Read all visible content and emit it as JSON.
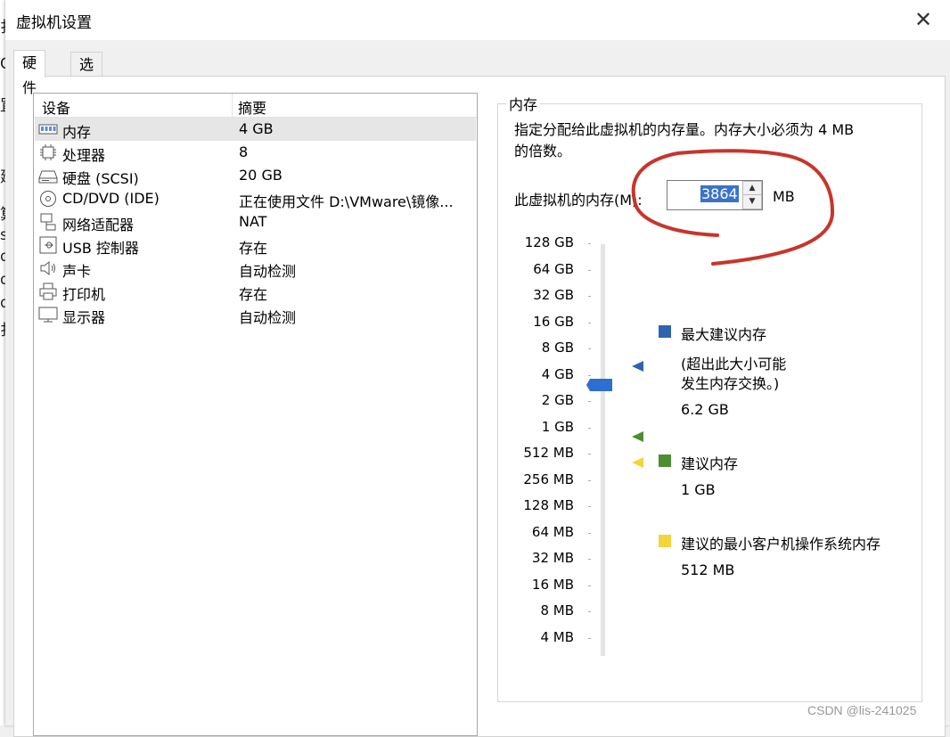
{
  "window": {
    "title": "虚拟机设置",
    "close_glyph": "✕"
  },
  "background_chars": [
    "扌",
    "C",
    "罝",
    "建",
    "算",
    "s",
    "d",
    "d",
    "d",
    "扌"
  ],
  "tabs": [
    {
      "label": "硬件",
      "active": true
    },
    {
      "label": "选项",
      "active": false
    }
  ],
  "device_list": {
    "headers": {
      "device": "设备",
      "summary": "摘要"
    },
    "rows": [
      {
        "icon": "memory-icon",
        "name": "内存",
        "summary": "4 GB",
        "selected": true
      },
      {
        "icon": "processor-icon",
        "name": "处理器",
        "summary": "8",
        "selected": false
      },
      {
        "icon": "harddisk-icon",
        "name": "硬盘 (SCSI)",
        "summary": "20 GB",
        "selected": false
      },
      {
        "icon": "cd-dvd-icon",
        "name": "CD/DVD (IDE)",
        "summary": "正在使用文件 D:\\VMware\\镜像...",
        "selected": false
      },
      {
        "icon": "network-adapter-icon",
        "name": "网络适配器",
        "summary": "NAT",
        "selected": false
      },
      {
        "icon": "usb-icon",
        "name": "USB 控制器",
        "summary": "存在",
        "selected": false
      },
      {
        "icon": "sound-card-icon",
        "name": "声卡",
        "summary": "自动检测",
        "selected": false
      },
      {
        "icon": "printer-icon",
        "name": "打印机",
        "summary": "存在",
        "selected": false
      },
      {
        "icon": "display-icon",
        "name": "显示器",
        "summary": "自动检测",
        "selected": false
      }
    ]
  },
  "memory": {
    "group_label": "内存",
    "description_line1": "指定分配给此虚拟机的内存量。内存大小必须为 4 MB",
    "description_line2": "的倍数。",
    "field_label": "此虚拟机的内存(M):",
    "value": "3864",
    "unit": "MB",
    "scale_labels": [
      "128 GB",
      "64 GB",
      "32 GB",
      "16 GB",
      "8 GB",
      "4 GB",
      "2 GB",
      "1 GB",
      "512 MB",
      "256 MB",
      "128 MB",
      "64 MB",
      "32 MB",
      "16 MB",
      "8 MB",
      "4 MB"
    ],
    "slider_position_label": "4 GB",
    "legend": {
      "max_recommended": {
        "title": "最大建议内存",
        "note_line1": "(超出此大小可能",
        "note_line2": "发生内存交换。)",
        "value": "6.2 GB",
        "color": "#2f63b1"
      },
      "recommended": {
        "title": "建议内存",
        "value": "1 GB",
        "color": "#4c8f2f"
      },
      "guest_min": {
        "title": "建议的最小客户机操作系统内存",
        "value": "512 MB",
        "color": "#f5d33a"
      }
    }
  },
  "watermark": "CSDN @lis-241025",
  "annotation_color": "#c8352b"
}
